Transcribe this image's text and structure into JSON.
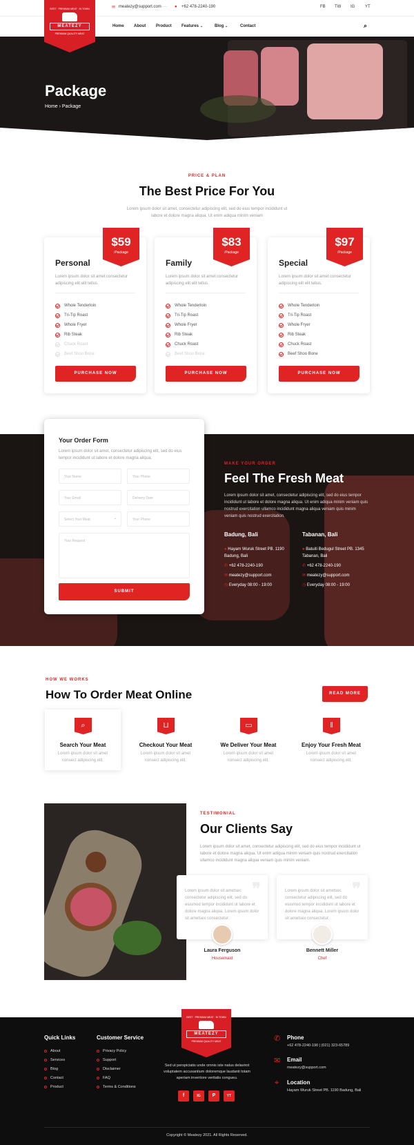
{
  "header": {
    "email": "meatezy@support.com",
    "phone": "+62 478-2240-190",
    "socials": [
      "FB",
      "TW",
      "IG",
      "YT"
    ],
    "logo": {
      "arc_top": "BEST · PREMIUM MEAT · IN TOWN",
      "name": "MEATEZY",
      "arc_bottom": "PREMIUM QUALITY MEAT"
    },
    "nav": [
      "Home",
      "About",
      "Product",
      "Features",
      "Blog",
      "Contact"
    ],
    "active_nav": "Features"
  },
  "hero": {
    "title": "Package",
    "breadcrumb": [
      "Home",
      "Package"
    ]
  },
  "pricing": {
    "eyebrow": "PRICE & PLAN",
    "title": "The Best Price For You",
    "desc": "Lorem ipsum dolor sit amet, consectetur adipiscing elit, sed do eius tempor incididunt ut labore et dolore magna aliqua. Ut enim adiqua minim veniam",
    "plans": [
      {
        "name": "Personal",
        "price": "$59",
        "per": "/Package",
        "desc": "Lorem ipsum dolor sit amet consectetur adipiscing elit elit tellus.",
        "items": [
          {
            "t": "Whole Tenderloin",
            "on": true
          },
          {
            "t": "Tri-Tip Roast",
            "on": true
          },
          {
            "t": "Whole Fryer",
            "on": true
          },
          {
            "t": "Rib Steak",
            "on": true
          },
          {
            "t": "Chuck Roast",
            "on": false
          },
          {
            "t": "Beef Shoo Bone",
            "on": false
          }
        ],
        "button": "PURCHASE NOW"
      },
      {
        "name": "Family",
        "price": "$83",
        "per": "/Package",
        "desc": "Lorem ipsum dolor sit amet consectetur adipiscing elit elit tellus.",
        "items": [
          {
            "t": "Whole Tenderloin",
            "on": true
          },
          {
            "t": "Tri-Tip Roast",
            "on": true
          },
          {
            "t": "Whole Fryer",
            "on": true
          },
          {
            "t": "Rib Steak",
            "on": true
          },
          {
            "t": "Chuck Roast",
            "on": true
          },
          {
            "t": "Beef Shoo Bone",
            "on": false
          }
        ],
        "button": "PURCHASE NOW"
      },
      {
        "name": "Special",
        "price": "$97",
        "per": "/Package",
        "desc": "Lorem ipsum dolor sit amet consectetur adipiscing elit elit tellus.",
        "items": [
          {
            "t": "Whole Tenderloin",
            "on": true
          },
          {
            "t": "Tri-Tip Roast",
            "on": true
          },
          {
            "t": "Whole Fryer",
            "on": true
          },
          {
            "t": "Rib Steak",
            "on": true
          },
          {
            "t": "Chuck Roast",
            "on": true
          },
          {
            "t": "Beef Shoo Bone",
            "on": true
          }
        ],
        "button": "PURCHASE NOW"
      }
    ]
  },
  "order_form": {
    "title": "Your Order Form",
    "desc": "Lorem ipsum dolor sit amet, consectetur adipiscing elit, sed do eius tempor incididunt ut labore et dolore magna aliqua.",
    "placeholders": {
      "name": "Your Name",
      "phone": "Your Phone",
      "email": "Your Email",
      "date": "Delivery Date",
      "meat": "Select Your Meat",
      "phone2": "Your Phone",
      "request": "Your Request"
    },
    "submit": "SUBMIT"
  },
  "order_info": {
    "eyebrow": "MAKE YOUR ORDER",
    "title": "Feel The Fresh Meat",
    "desc": "Lorem ipsum dolor sit amet, consectetur adipiscing elit, sed do eius tempor incididunt ut labore et dolore magna aliqua. Ut enim adiqua minim veniam quis nostrud exercitation ullamco incididunt magna aliqua veniam quis minim veniam quis nostrud exercitation.",
    "locations": [
      {
        "city": "Badung, Bali",
        "address": "Hayam Wuruk Street PB. 1190 Badung, Bali",
        "phone": "+62 478-2240-190",
        "email": "meatezy@support.com",
        "hours": "Everyday 08:00 - 19:00"
      },
      {
        "city": "Tabanan, Bali",
        "address": "Batuiti Bedugul Street PB. 1345 Tabanan, Bali",
        "phone": "+62 478-2240-190",
        "email": "meatezy@support.com",
        "hours": "Everyday 08:00 - 19:00"
      }
    ]
  },
  "how": {
    "eyebrow": "HOW WE WORKS",
    "title": "How To Order Meat Online",
    "button": "READ MORE",
    "steps": [
      {
        "title": "Search Your Meat",
        "desc": "Lorem ipsum dolor sit amet consect adipiscing elit.",
        "icon": "search-icon"
      },
      {
        "title": "Checkout Your Meat",
        "desc": "Lorem ipsum dolor sit amet consect adipiscing elit.",
        "icon": "basket-icon"
      },
      {
        "title": "We Deliver Your Meat",
        "desc": "Lorem ipsum dolor sit amet consect adipiscing elit.",
        "icon": "truck-icon"
      },
      {
        "title": "Enjoy Your Fresh Meat",
        "desc": "Lorem ipsum dolor sit amet consect adipiscing elit.",
        "icon": "utensils-icon"
      }
    ]
  },
  "testimonial": {
    "eyebrow": "TESTIMONIAL",
    "title": "Our Clients Say",
    "desc": "Lorem ipsum dolor sit amet, consectetur adipiscing elit, sed do eius tempor incididunt ut labore et dolore magna aliqua. Ut enim adiqua minim veniam quis nostrud exercitation ullamco incididunt magna aliqua veniam quis minim veniam.",
    "reviews": [
      {
        "text": "Lorem ipsum dolor sit ametsec consectetur adipiscing elit, sed do eiusmod tempor incididunt ut labore et dolore magna aliqua. Lorem ipsum dolor sit ametsex consectetur.",
        "name": "Laura Ferguson",
        "role": "Housemaid"
      },
      {
        "text": "Lorem ipsum dolor sit ametsec consectetur adipiscing elit, sed do eiusmod tempor incididunt ut labore et dolore magna aliqua. Lorem ipsum dolor sit ametsex consectetur.",
        "name": "Bennett Miller",
        "role": "Chef"
      }
    ]
  },
  "footer": {
    "quick_title": "Quick Links",
    "quick": [
      "About",
      "Services",
      "Blog",
      "Contact",
      "Product"
    ],
    "cs_title": "Customer Service",
    "cs": [
      "Privacy Policy",
      "Support",
      "Disclaimer",
      "FAQ",
      "Terms & Conditions"
    ],
    "about": "Sed ut perspiciatis unde omnis iste natus delavirot voluptatem accusantium doloremque laudanti totam aperiam inventore veritatis congueu.",
    "social": [
      "f",
      "IG",
      "P",
      "YT"
    ],
    "contact": [
      {
        "label": "Phone",
        "value": "+62 478-2240-190 | (021) 323-65789"
      },
      {
        "label": "Email",
        "value": "meatezy@support.com"
      },
      {
        "label": "Location",
        "value": "Hayam Wuruk Street PB. 1190 Badung, Bali"
      }
    ],
    "copyright": "Copyright © Meatezy 2021. All Rights Reserved."
  },
  "colors": {
    "accent": "#e02424",
    "dark": "#0e0e0e"
  }
}
